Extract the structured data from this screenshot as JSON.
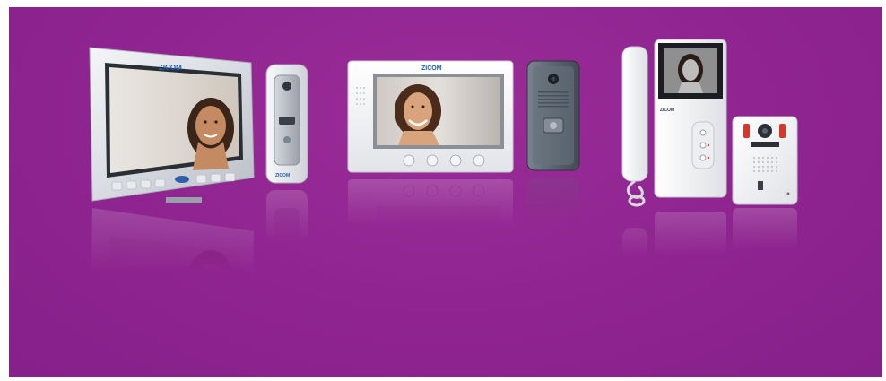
{
  "brand": {
    "name": "ZICOM",
    "color": "#1e5fb3"
  },
  "colors": {
    "background": "#8f2490",
    "device_white": "#f2f2f4",
    "device_silver": "#c8ccd2",
    "doorbell_dark": "#5c6670"
  },
  "products": [
    {
      "id": "monitor-7in-silver",
      "icon": "video-monitor-icon"
    },
    {
      "id": "door-camera-silver",
      "icon": "door-camera-icon"
    },
    {
      "id": "monitor-7in-white",
      "icon": "video-monitor-icon"
    },
    {
      "id": "door-camera-dark",
      "icon": "door-camera-icon"
    },
    {
      "id": "handset-monitor",
      "icon": "intercom-handset-icon"
    },
    {
      "id": "door-camera-red",
      "icon": "door-camera-icon"
    }
  ]
}
